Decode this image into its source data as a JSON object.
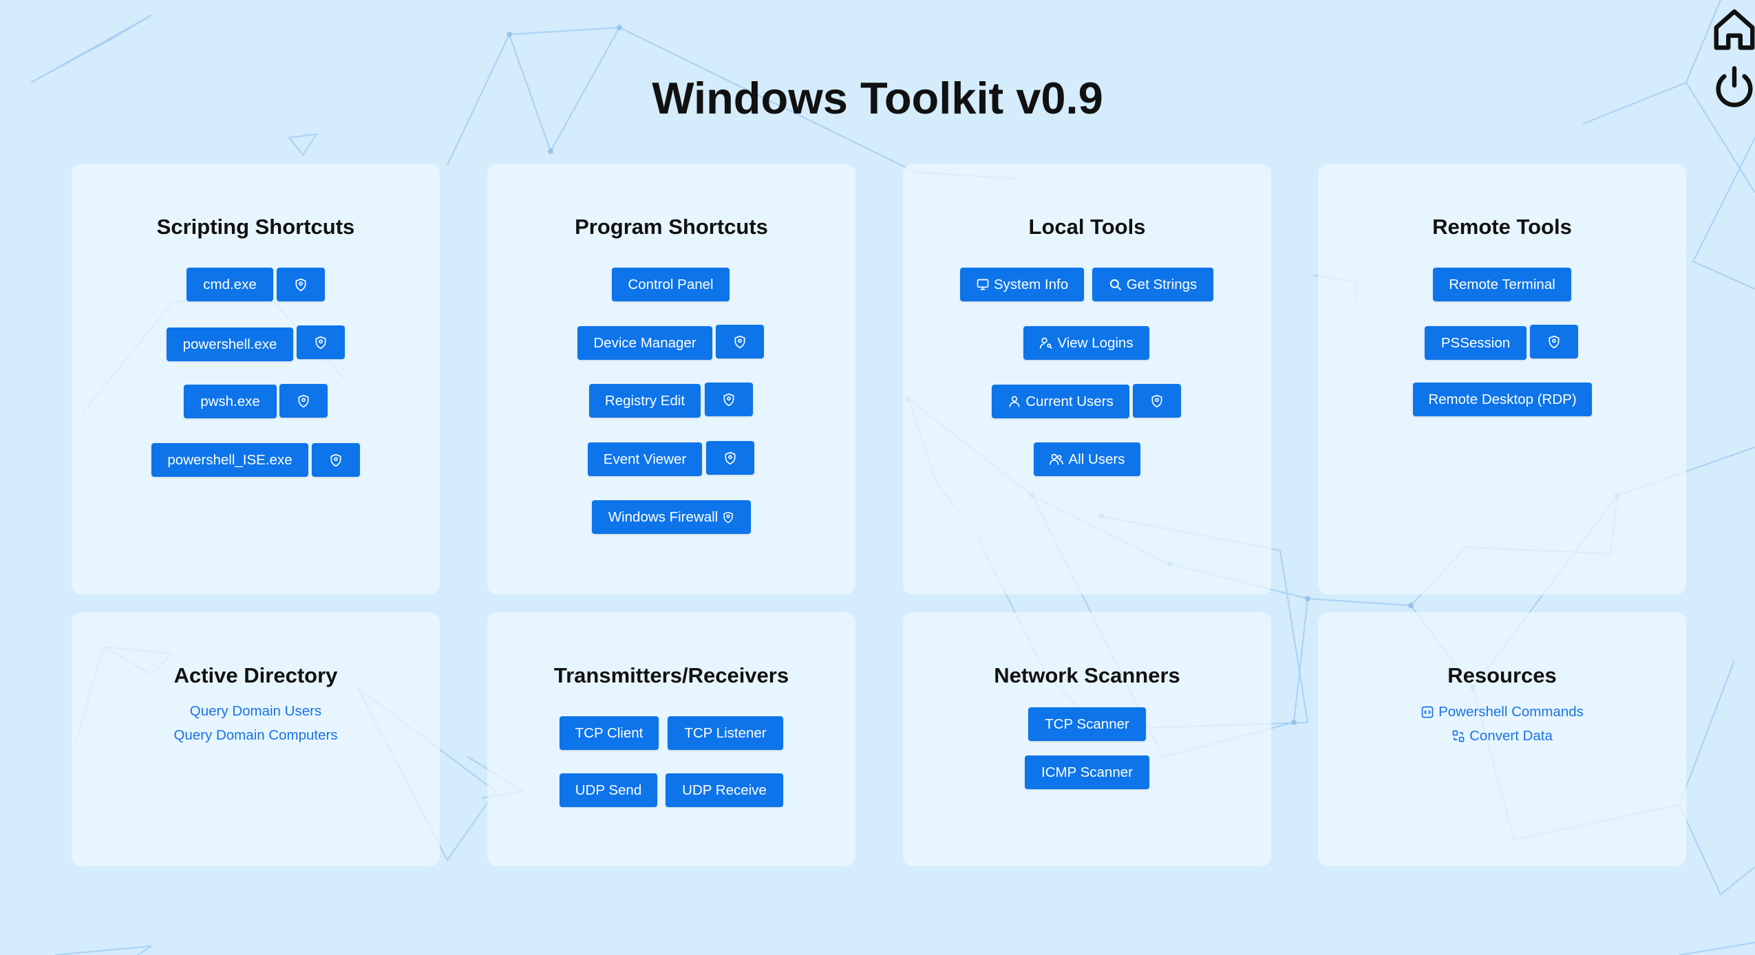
{
  "title": "Windows Toolkit v0.9",
  "nav": {
    "home_icon": "home-icon",
    "power_icon": "power-icon"
  },
  "colors": {
    "background": "#d4ecfb",
    "card": "#eef8ff",
    "button": "#0d74ea",
    "link": "#1a73e8"
  },
  "cards": {
    "scripting": {
      "title": "Scripting Shortcuts",
      "buttons": [
        "cmd.exe",
        "powershell.exe",
        "pwsh.exe",
        "powershell_ISE.exe"
      ],
      "admin_icon": "shield-icon"
    },
    "program": {
      "title": "Program Shortcuts",
      "buttons": [
        "Control Panel",
        "Device Manager",
        "Registry Edit",
        "Event Viewer",
        "Windows Firewall"
      ]
    },
    "local": {
      "title": "Local Tools",
      "buttons": [
        "System Info",
        "Get Strings",
        "View Logins",
        "Current Users",
        "All Users"
      ]
    },
    "remote": {
      "title": "Remote Tools",
      "buttons": [
        "Remote Terminal",
        "PSSession",
        "Remote Desktop (RDP)"
      ]
    },
    "ad": {
      "title": "Active Directory",
      "links": [
        "Query Domain Users",
        "Query Domain Computers"
      ]
    },
    "txrx": {
      "title": "Transmitters/Receivers",
      "buttons": [
        "TCP Client",
        "TCP Listener",
        "UDP Send",
        "UDP Receive"
      ]
    },
    "netscan": {
      "title": "Network Scanners",
      "buttons": [
        "TCP Scanner",
        "ICMP Scanner"
      ]
    },
    "resources": {
      "title": "Resources",
      "links": [
        "Powershell Commands",
        "Convert Data"
      ]
    }
  }
}
